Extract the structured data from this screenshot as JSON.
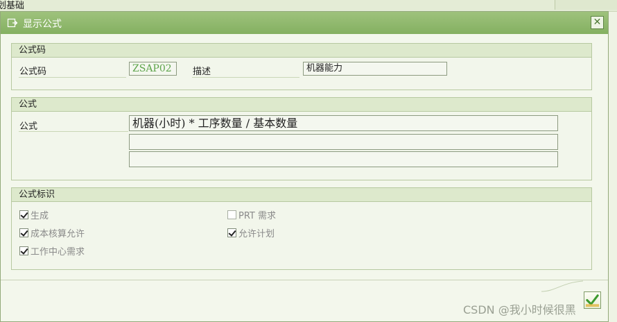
{
  "background": {
    "title_fragment": "划基础"
  },
  "dialog": {
    "title": "显示公式",
    "close_symbol": "✕"
  },
  "group_formula_code": {
    "header": "公式码",
    "code_label": "公式码",
    "code_value": "ZSAP02",
    "desc_label": "描述",
    "desc_value": "机器能力"
  },
  "group_formula": {
    "header": "公式",
    "label": "公式",
    "lines": [
      "机器(小时) * 工序数量 / 基本数量",
      "",
      ""
    ]
  },
  "group_flags": {
    "header": "公式标识",
    "flags": [
      {
        "label": "生成",
        "checked": true
      },
      {
        "label": "PRT 需求",
        "checked": false
      },
      {
        "label": "成本核算允许",
        "checked": true
      },
      {
        "label": "允许计划",
        "checked": true
      },
      {
        "label": "工作中心需求",
        "checked": true
      }
    ]
  },
  "watermark": "CSDN @我小时候很黑",
  "colors": {
    "title_bar": "#8ab767",
    "accent_green": "#5da44a"
  }
}
